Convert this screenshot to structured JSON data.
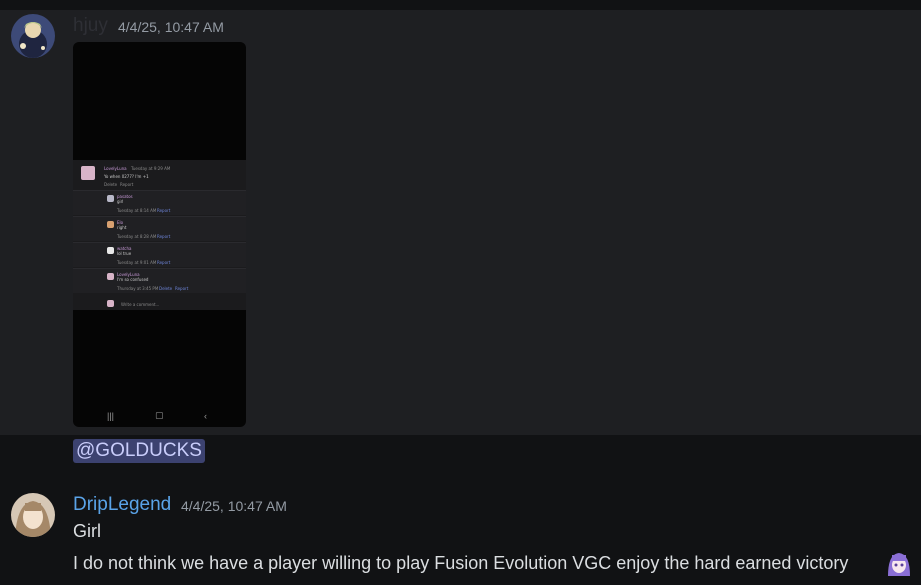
{
  "messages": [
    {
      "author": "hjuy",
      "timestamp": "4/4/25, 10:47 AM",
      "author_color": "#2e2f35",
      "attachment": {
        "kind": "phone-screenshot",
        "thread": [
          {
            "author": "LovelyLuna",
            "time": "Tuesday at 9:29 AM",
            "text": "Yo when 0277? I'm +1",
            "actions": [
              "Delete",
              "Report"
            ]
          },
          {
            "author": "pasatos",
            "text": "girl",
            "time": "Tuesday at 8:14 AM",
            "action": "Report"
          },
          {
            "author": "Elo",
            "text": "right",
            "time": "Tuesday at 8:28 AM",
            "action": "Report"
          },
          {
            "author": "watcha",
            "text": "lol true",
            "time": "Tuesday at 9:01 AM",
            "action": "Report"
          },
          {
            "author": "LovelyLuna",
            "text": "I'm so confused",
            "time": "Thursday at 3:45 PM",
            "actions": [
              "Delete",
              "Report"
            ]
          }
        ],
        "comment_placeholder": "Write a comment...",
        "nav_icons": [
          "recent-apps-icon",
          "home-icon",
          "back-icon"
        ]
      },
      "mention": "@GOLDUCKS"
    },
    {
      "author": "DripLegend",
      "timestamp": "4/4/25, 10:47 AM",
      "author_color": "#5aa3e8",
      "lines": [
        "Girl",
        "I do not think we have a player willing to play Fusion Evolution VGC enjoy the hard earned victory"
      ],
      "trailing_emoji": "anime-girl-emoji-icon"
    }
  ],
  "colors": {
    "background": "#1e1f22",
    "text": "#dbdee1",
    "muted": "#949ba4",
    "mention_bg": "#3c4270",
    "mention_text": "#c9cdfb"
  }
}
